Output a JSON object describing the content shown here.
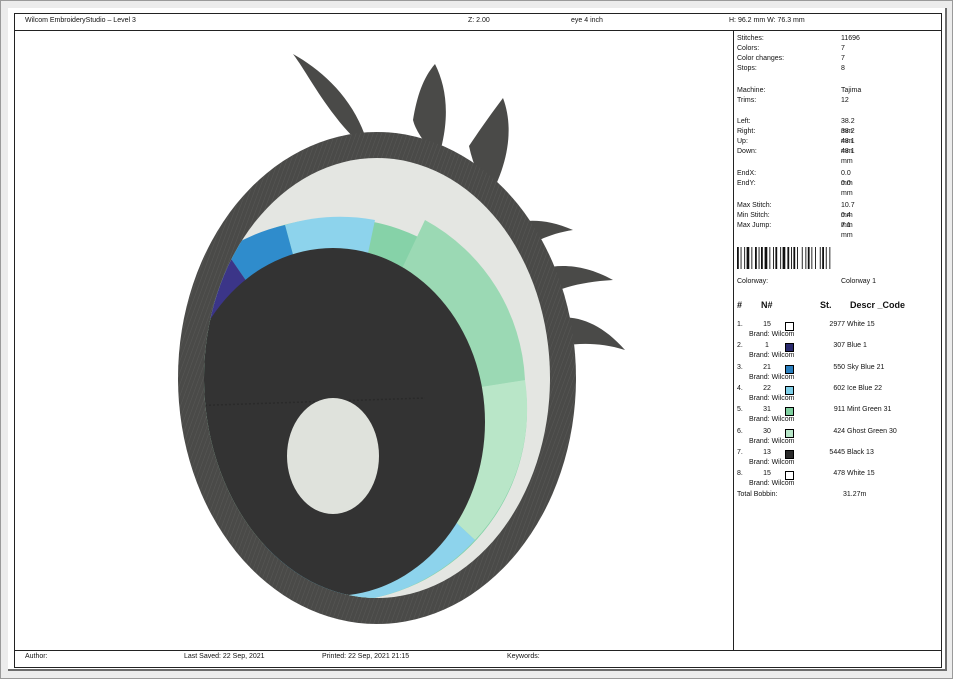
{
  "header": {
    "app_title": "Wilcom EmbroideryStudio – Level 3",
    "zoom": "Z: 2.00",
    "design_name": "eye 4 inch",
    "dimensions": "H: 96.2 mm   W: 76.3 mm"
  },
  "stats": [
    {
      "label": "Stitches:",
      "value": "11696"
    },
    {
      "label": "Colors:",
      "value": "7"
    },
    {
      "label": "Color changes:",
      "value": "7"
    },
    {
      "label": "Stops:",
      "value": "8"
    },
    {
      "label": "Machine:",
      "value": "Tajima"
    },
    {
      "label": "Trims:",
      "value": "12"
    },
    {
      "label": "Left:",
      "value": "38.2 mm"
    },
    {
      "label": "Right:",
      "value": "38.2 mm"
    },
    {
      "label": "Up:",
      "value": "48.1 mm"
    },
    {
      "label": "Down:",
      "value": "48.1 mm"
    },
    {
      "label": "EndX:",
      "value": "0.0 mm"
    },
    {
      "label": "EndY:",
      "value": "0.0 mm"
    },
    {
      "label": "Max Stitch:",
      "value": "10.7 mm"
    },
    {
      "label": "Min Stitch:",
      "value": "0.4 mm"
    },
    {
      "label": "Max Jump:",
      "value": "7.1 mm"
    }
  ],
  "colorway": {
    "label": "Colorway:",
    "value": "Colorway 1"
  },
  "thread_table": {
    "headers": [
      "#",
      "N#",
      "St.",
      "Descr _Code"
    ],
    "rows": [
      {
        "index": "1.",
        "n": "15",
        "color": "#ffffff",
        "stitches": "2977",
        "descr": "White 15",
        "brand": "Brand: Wilcom"
      },
      {
        "index": "2.",
        "n": "1",
        "color": "#2a2a6e",
        "stitches": "307",
        "descr": "Blue 1",
        "brand": "Brand: Wilcom"
      },
      {
        "index": "3.",
        "n": "21",
        "color": "#2a7fbf",
        "stitches": "550",
        "descr": "Sky Blue 21",
        "brand": "Brand: Wilcom"
      },
      {
        "index": "4.",
        "n": "22",
        "color": "#7fcfe8",
        "stitches": "602",
        "descr": "Ice Blue 22",
        "brand": "Brand: Wilcom"
      },
      {
        "index": "5.",
        "n": "31",
        "color": "#7fcf9f",
        "stitches": "911",
        "descr": "Mint Green 31",
        "brand": "Brand: Wilcom"
      },
      {
        "index": "6.",
        "n": "30",
        "color": "#b8e6c8",
        "stitches": "424",
        "descr": "Ghost Green 30",
        "brand": "Brand: Wilcom"
      },
      {
        "index": "7.",
        "n": "13",
        "color": "#2a2a2a",
        "stitches": "5445",
        "descr": "Black 13",
        "brand": "Brand: Wilcom"
      },
      {
        "index": "8.",
        "n": "15",
        "color": "#ffffff",
        "stitches": "478",
        "descr": "White 15",
        "brand": "Brand: Wilcom"
      }
    ]
  },
  "total_bobbin": {
    "label": "Total Bobbin:",
    "value": "31.27m"
  },
  "footer": {
    "author": "Author:",
    "last_saved": "Last Saved: 22 Sep, 2021",
    "printed": "Printed: 22 Sep, 2021 21:15",
    "keywords": "Keywords:"
  },
  "colors": {
    "outline": "#4a4a48",
    "eye_white": "#e4e6e2",
    "pupil": "#333333",
    "highlight": "#dfe2dc",
    "mint": "#86d2a8",
    "ghost": "#b9e6c8",
    "sky": "#2f8ccc",
    "ice": "#8dd3ec",
    "navy": "#3b3588"
  }
}
